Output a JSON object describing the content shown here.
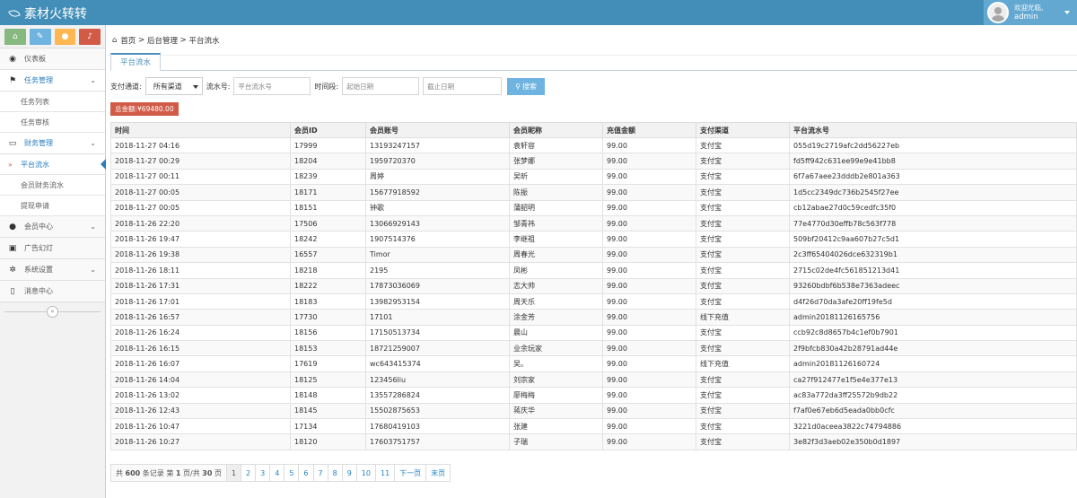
{
  "app": {
    "title": "素材火转转",
    "welcome": "欢迎光临,",
    "user": "admin"
  },
  "sidebar": {
    "items": [
      {
        "label": "仪表板"
      },
      {
        "label": "任务管理"
      },
      {
        "label": "任务列表"
      },
      {
        "label": "任务审核"
      },
      {
        "label": "财务管理"
      },
      {
        "label": "平台流水"
      },
      {
        "label": "会员财务流水"
      },
      {
        "label": "提现申请"
      },
      {
        "label": "会员中心"
      },
      {
        "label": "广告幻灯"
      },
      {
        "label": "系统设置"
      },
      {
        "label": "消息中心"
      }
    ],
    "collapse": "«"
  },
  "breadcrumb": {
    "home": "首页",
    "sep1": ">",
    "admin": "后台管理",
    "sep2": ">",
    "current": "平台流水"
  },
  "tab": {
    "label": "平台流水"
  },
  "filters": {
    "channel_label": "支付通道:",
    "channel_value": "所有渠道",
    "serial_label": "流水号:",
    "serial_placeholder": "平台流水号",
    "time_label": "时间段:",
    "start_placeholder": "起始日期",
    "end_placeholder": "截止日期",
    "search_label": "搜索"
  },
  "total": {
    "label": "总金额:¥69480.00"
  },
  "table": {
    "headers": [
      "时间",
      "会员ID",
      "会员账号",
      "会员昵称",
      "充值金额",
      "支付渠道",
      "平台流水号"
    ],
    "rows": [
      [
        "2018-11-27 04:16",
        "17999",
        "13193247157",
        "袁轩容",
        "99.00",
        "支付宝",
        "055d19c2719afc2dd56227eb"
      ],
      [
        "2018-11-27 00:29",
        "18204",
        "1959720370",
        "张梦娜",
        "99.00",
        "支付宝",
        "fd5ff942c631ee99e9e41bb8"
      ],
      [
        "2018-11-27 00:11",
        "18239",
        "周婷",
        "吴昕",
        "99.00",
        "支付宝",
        "6f7a67aee23dddb2e801a363"
      ],
      [
        "2018-11-27 00:05",
        "18171",
        "15677918592",
        "陈振",
        "99.00",
        "支付宝",
        "1d5cc2349dc736b2545f27ee"
      ],
      [
        "2018-11-27 00:05",
        "18151",
        "钟歌",
        "蒲韶明",
        "99.00",
        "支付宝",
        "cb12abae27d0c59cedfc35f0"
      ],
      [
        "2018-11-26 22:20",
        "17506",
        "13066929143",
        "邹青祎",
        "99.00",
        "支付宝",
        "77e4770d30effb78c563f778"
      ],
      [
        "2018-11-26 19:47",
        "18242",
        "1907514376",
        "李继祖",
        "99.00",
        "支付宝",
        "509bf20412c9aa607b27c5d1"
      ],
      [
        "2018-11-26 19:38",
        "16557",
        "Timor",
        "周春光",
        "99.00",
        "支付宝",
        "2c3ff65404026dce632319b1"
      ],
      [
        "2018-11-26 18:11",
        "18218",
        "2195",
        "凤彬",
        "99.00",
        "支付宝",
        "2715c02de4fc561851213d41"
      ],
      [
        "2018-11-26 17:31",
        "18222",
        "17873036069",
        "志大帅",
        "99.00",
        "支付宝",
        "93260bdbf6b538e7363adeec"
      ],
      [
        "2018-11-26 17:01",
        "18183",
        "13982953154",
        "周天乐",
        "99.00",
        "支付宝",
        "d4f26d70da3afe20ff19fe5d"
      ],
      [
        "2018-11-26 16:57",
        "17730",
        "17101",
        "涂金芳",
        "99.00",
        "线下充值",
        "admin20181126165756"
      ],
      [
        "2018-11-26 16:24",
        "18156",
        "17150513734",
        "晨山",
        "99.00",
        "支付宝",
        "ccb92c8d8657b4c1ef0b7901"
      ],
      [
        "2018-11-26 16:15",
        "18153",
        "18721259007",
        "业余玩家",
        "99.00",
        "支付宝",
        "2f9bfcb830a42b28791ad44e"
      ],
      [
        "2018-11-26 16:07",
        "17619",
        "wc643415374",
        "吴。",
        "99.00",
        "线下充值",
        "admin20181126160724"
      ],
      [
        "2018-11-26 14:04",
        "18125",
        "123456liu",
        "刘宗家",
        "99.00",
        "支付宝",
        "ca27f912477e1f5e4e377e13"
      ],
      [
        "2018-11-26 13:02",
        "18148",
        "13557286824",
        "廖梅梅",
        "99.00",
        "支付宝",
        "ac83a772da3ff25572b9db22"
      ],
      [
        "2018-11-26 12:43",
        "18145",
        "15502875653",
        "蒋庆华",
        "99.00",
        "支付宝",
        "f7af0e67eb6d5eada0bb0cfc"
      ],
      [
        "2018-11-26 10:47",
        "17134",
        "17680419103",
        "张建",
        "99.00",
        "支付宝",
        "3221d0aceea3822c74794886"
      ],
      [
        "2018-11-26 10:27",
        "18120",
        "17603751757",
        "子瑞",
        "99.00",
        "支付宝",
        "3e82f3d3aeb02e350b0d1897"
      ]
    ]
  },
  "pager": {
    "info_prefix": "共",
    "total": "600",
    "info_mid": "条记录 第",
    "page": "1",
    "info_mid2": "页/共",
    "pages": "30",
    "info_suffix": "页",
    "numbers": [
      "1",
      "2",
      "3",
      "4",
      "5",
      "6",
      "7",
      "8",
      "9",
      "10",
      "11"
    ],
    "next": "下一页",
    "last": "末页"
  }
}
